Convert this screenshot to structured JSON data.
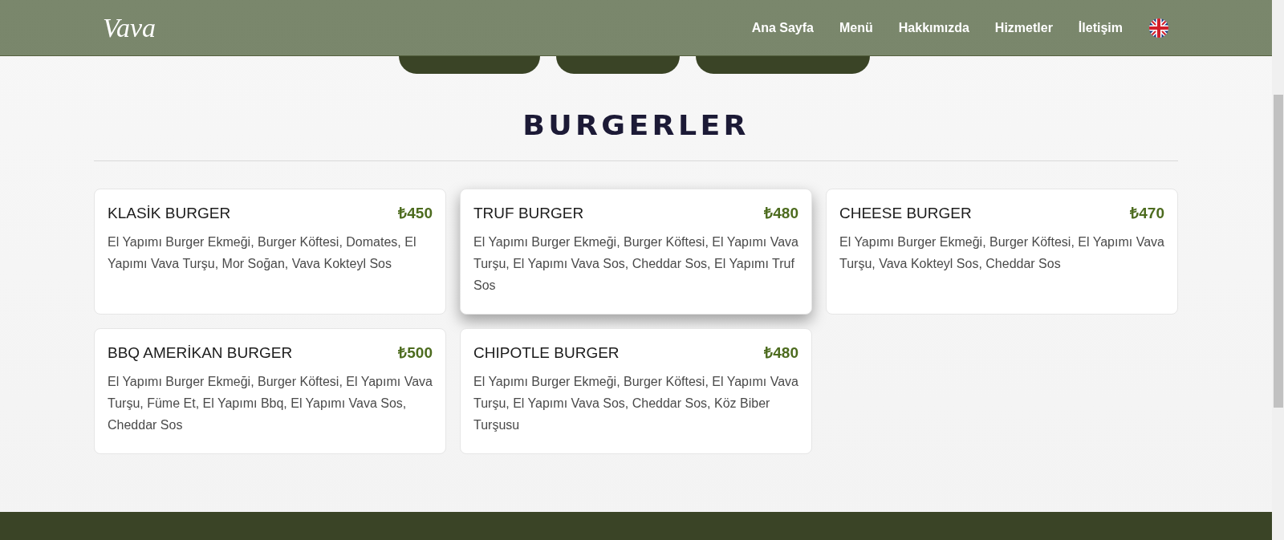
{
  "header": {
    "logo": "Vava",
    "nav": [
      {
        "label": "Ana Sayfa"
      },
      {
        "label": "Menü"
      },
      {
        "label": "Hakkımızda"
      },
      {
        "label": "Hizmetler"
      },
      {
        "label": "İletişim"
      }
    ]
  },
  "section": {
    "title": "BURGERLER"
  },
  "items": [
    {
      "name": "KLASİK BURGER",
      "price": "₺450",
      "description": "El Yapımı Burger Ekmeği, Burger Köftesi, Domates, El Yapımı Vava Turşu, Mor Soğan, Vava Kokteyl Sos",
      "selected": false
    },
    {
      "name": "TRUF BURGER",
      "price": "₺480",
      "description": "El Yapımı Burger Ekmeği, Burger Köftesi, El Yapımı Vava Turşu, El Yapımı Vava Sos, Cheddar Sos, El Yapımı Truf Sos",
      "selected": true
    },
    {
      "name": "CHEESE BURGER",
      "price": "₺470",
      "description": "El Yapımı Burger Ekmeği, Burger Köftesi, El Yapımı Vava Turşu, Vava Kokteyl Sos, Cheddar Sos",
      "selected": false
    },
    {
      "name": "BBQ AMERİKAN BURGER",
      "price": "₺500",
      "description": "El Yapımı Burger Ekmeği, Burger Köftesi, El Yapımı Vava Turşu, Füme Et, El Yapımı Bbq, El Yapımı Vava Sos, Cheddar Sos",
      "selected": false
    },
    {
      "name": "CHIPOTLE BURGER",
      "price": "₺480",
      "description": "El Yapımı Burger Ekmeği, Burger Köftesi, El Yapımı Vava Turşu, El Yapımı Vava Sos, Cheddar Sos, Köz Biber Turşusu",
      "selected": false
    }
  ]
}
